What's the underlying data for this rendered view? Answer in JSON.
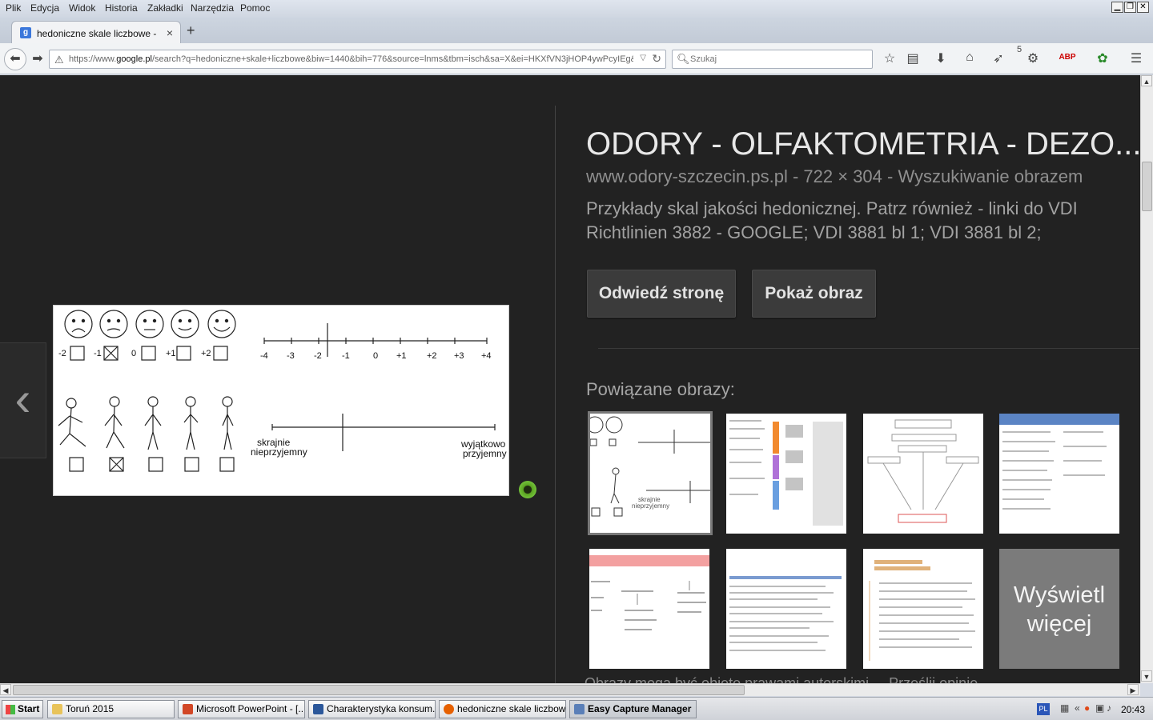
{
  "menubar": {
    "items": [
      "Plik",
      "Edycja",
      "Widok",
      "Historia",
      "Zakładki",
      "Narzędzia",
      "Pomoc"
    ]
  },
  "tab": {
    "favicon": "g",
    "title": "hedoniczne skale liczbowe - S...",
    "close": "×",
    "newtab": "+"
  },
  "navbar": {
    "url_prefix": "https://www.",
    "url_host": "google.pl",
    "url_rest": "/search?q=hedoniczne+skale+liczbowe&biw=1440&bih=776&source=lnms&tbm=isch&sa=X&ei=HKXfVN3jHOP4ywPcyIEg&v",
    "search_placeholder": "Szukaj",
    "badge_count": "5"
  },
  "detail": {
    "title": "ODORY - OLFAKTOMETRIA - DEZO...",
    "meta": "www.odory-szczecin.ps.pl - 722 × 304 - Wyszukiwanie obrazem",
    "description": "Przykłady skal jakości hedonicznej. Patrz również - linki do VDI Richtlinien 3882 - GOOGLE; VDI 3881 bl 1; VDI 3881 bl 2;",
    "visit_button": "Odwiedź stronę",
    "show_button": "Pokaż obraz",
    "related_label": "Powiązane obrazy:",
    "more_label": "Wyświetl więcej",
    "footer": "Obrazy mogą być objęte prawami autorskimi. – Prześlij opinię"
  },
  "preview": {
    "face_scores": [
      "-2",
      "-1",
      "0",
      "+1",
      "+2"
    ],
    "checked_index": 1,
    "scale_ticks": [
      "-4",
      "-3",
      "-2",
      "-1",
      "0",
      "+1",
      "+2",
      "+3",
      "+4"
    ],
    "left_label_1": "skrajnie",
    "left_label_2": "nieprzyjemny",
    "right_label_1": "wyjątkowo",
    "right_label_2": "przyjemny",
    "thumb_left_label_1": "skrajnie",
    "thumb_left_label_2": "nieprzyjemny"
  },
  "taskbar": {
    "start": "Start",
    "tasks": [
      "Toruń 2015",
      "Microsoft PowerPoint - [...",
      "Charakterystyka konsum...",
      "hedoniczne skale liczbow...",
      "Easy Capture Manager"
    ],
    "lang": "PL",
    "clock": "20:43"
  },
  "colors": {
    "content_bg": "#222222",
    "title_text": "#e8e8e8",
    "button_bg": "#3b3b3b",
    "tab_favicon": "#3b77db"
  }
}
